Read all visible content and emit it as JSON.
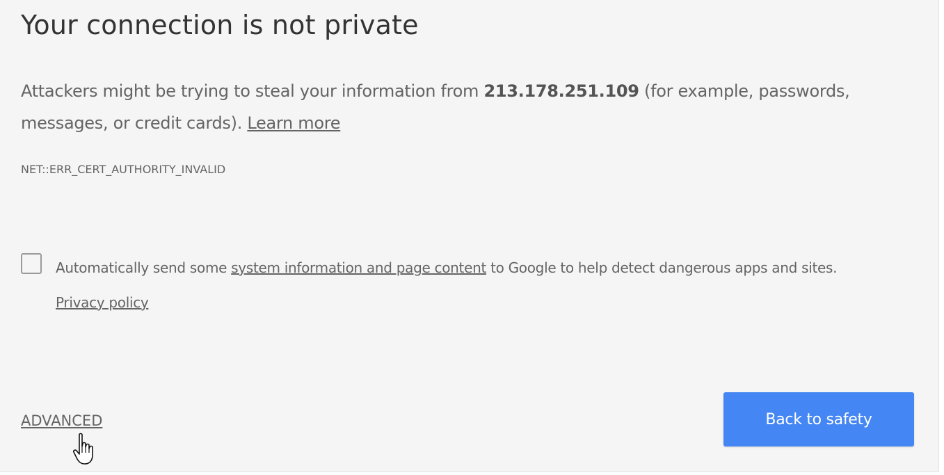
{
  "interstitial": {
    "title": "Your connection is not private",
    "message": {
      "prefix": "Attackers might be trying to steal your information from ",
      "host": "213.178.251.109",
      "suffix": " (for example, passwords, messages, or credit cards). ",
      "learn_more_label": "Learn more"
    },
    "error_code": "NET::ERR_CERT_AUTHORITY_INVALID",
    "report_opt_in": {
      "checked": false,
      "text_before": "Automatically send some ",
      "link_label": "system information and page content",
      "text_after": " to Google to help detect dangerous apps and sites. ",
      "privacy_label": "Privacy policy"
    },
    "advanced_label": "ADVANCED",
    "back_button_label": "Back to safety"
  },
  "cursor": {
    "icon": "hand-pointer-icon"
  },
  "colors": {
    "background": "#f5f5f5",
    "text": "#646464",
    "title": "#333333",
    "primary_button": "#4486f3"
  }
}
